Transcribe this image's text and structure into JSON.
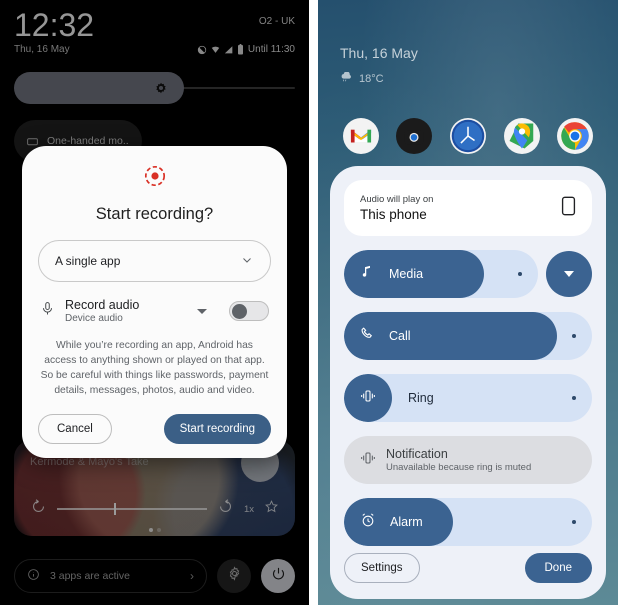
{
  "left_phone": {
    "status_bar": {
      "clock": "12:32",
      "carrier": "O2 - UK",
      "date": "Thu, 16 May",
      "battery_until": "Until 11:30",
      "icons": [
        "dnd-icon",
        "wifi-icon",
        "signal-icon",
        "battery-icon"
      ]
    },
    "brightness": {
      "name": "brightness-slider",
      "level_percent": 58
    },
    "quick_tile": {
      "label": "One-handed mo..",
      "icon": "one-handed-icon"
    },
    "media_player": {
      "title": "Kermode & Mayo's Take",
      "rewind_icon": "replay-10-icon",
      "forward_icon": "forward-30-icon",
      "speed_label": "1x",
      "favorite_icon": "star-icon",
      "progress_percent": 38
    },
    "footer": {
      "apps_active_label": "3 apps are active",
      "info_icon": "info-icon",
      "chevron": "›",
      "settings_icon": "gear-icon",
      "power_icon": "power-icon"
    },
    "dialog": {
      "icon": "screen-record-icon",
      "title": "Start recording?",
      "select_value": "A single app",
      "select_chevron": "chevron-down-icon",
      "record_audio_label": "Record audio",
      "record_audio_sub": "Device audio",
      "mic_icon": "microphone-icon",
      "toggle_state": "off",
      "warning": "While you’re recording an app, Android has access to anything shown or played on that app. So be careful with things like passwords, payment details, messages, photos, audio and video.",
      "cancel_label": "Cancel",
      "confirm_label": "Start recording",
      "accent_color": "#3b5f86",
      "record_icon_color": "#d93025"
    }
  },
  "right_phone": {
    "home": {
      "date": "Thu, 16 May",
      "temperature": "18°C",
      "weather_icon": "cloud-rain-icon",
      "dock_apps": [
        "gmail-icon",
        "camera-icon",
        "clock-icon",
        "maps-icon",
        "chrome-icon"
      ]
    },
    "volume_panel": {
      "output_label": "Audio will play on",
      "output_value": "This phone",
      "output_icon": "phone-device-icon",
      "expand_icon": "chevron-down-icon",
      "sliders": [
        {
          "name": "media",
          "label": "Media",
          "icon": "music-note-icon",
          "level_percent": 72,
          "state": "enabled"
        },
        {
          "name": "call",
          "label": "Call",
          "icon": "phone-call-icon",
          "level_percent": 86,
          "state": "enabled"
        },
        {
          "name": "ring",
          "label": "Ring",
          "icon": "vibrate-icon",
          "level_percent": 0,
          "state": "muted"
        },
        {
          "name": "notification",
          "label": "Notification",
          "sublabel": "Unavailable because ring is muted",
          "icon": "vibrate-icon",
          "level_percent": 0,
          "state": "disabled"
        },
        {
          "name": "alarm",
          "label": "Alarm",
          "icon": "alarm-clock-icon",
          "level_percent": 44,
          "state": "enabled"
        }
      ],
      "settings_label": "Settings",
      "done_label": "Done",
      "accent_color": "#3b6391",
      "track_color": "#d5e2f5"
    }
  }
}
